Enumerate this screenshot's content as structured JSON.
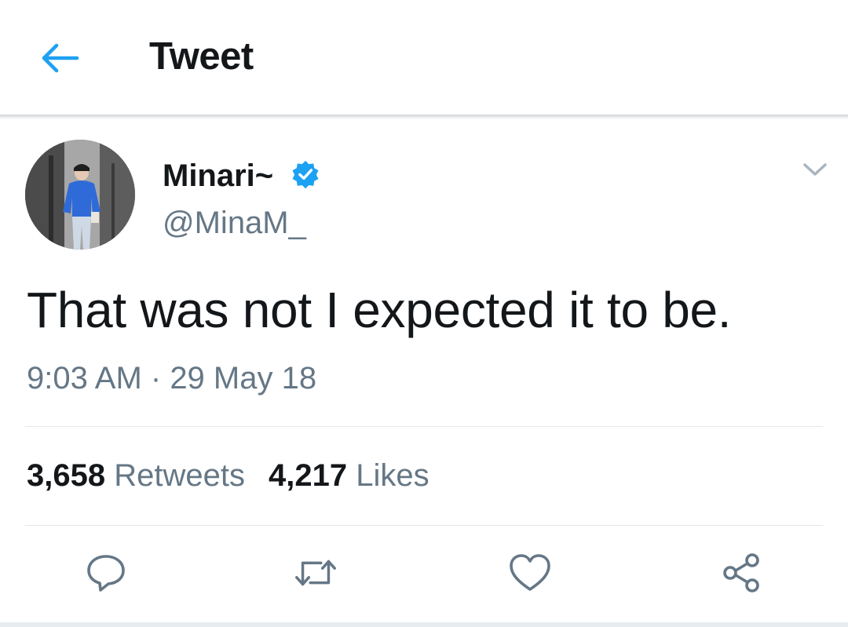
{
  "header": {
    "back_icon": "arrow-left-icon",
    "title": "Tweet",
    "accent_color": "#1da1f2"
  },
  "author": {
    "display_name": "Minari~",
    "handle": "@MinaM_",
    "verified": true,
    "verified_icon": "verified-badge-icon",
    "menu_icon": "chevron-down-icon"
  },
  "tweet": {
    "text": "That was not I expected it to be.",
    "time": "9:03 AM",
    "separator": " · ",
    "date": "29 May 18"
  },
  "stats": {
    "retweets_count": "3,658",
    "retweets_label": " Retweets",
    "likes_count": "4,217",
    "likes_label": " Likes"
  },
  "actions": [
    {
      "icon": "reply-icon"
    },
    {
      "icon": "retweet-icon"
    },
    {
      "icon": "like-icon"
    },
    {
      "icon": "share-icon"
    }
  ],
  "colors": {
    "text_primary": "#14171a",
    "text_secondary": "#657786",
    "divider": "#e1e8ed",
    "verified": "#1da1f2"
  }
}
